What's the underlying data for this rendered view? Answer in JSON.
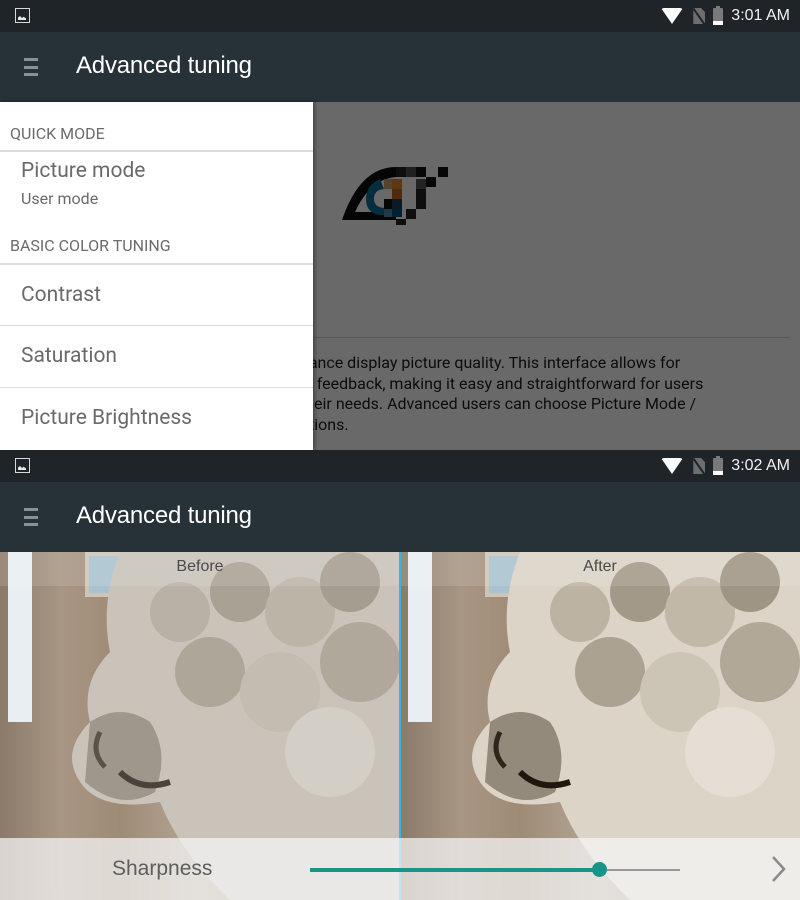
{
  "screens": [
    {
      "status_bar": {
        "time": "3:01 AM"
      },
      "app_bar": {
        "title": "Advanced tuning"
      },
      "drawer": {
        "sections": [
          {
            "header": "QUICK MODE",
            "items": [
              {
                "title": "Picture mode",
                "subtitle": "User mode"
              }
            ]
          },
          {
            "header": "BASIC COLOR TUNING",
            "items": [
              {
                "title": "Contrast"
              },
              {
                "title": "Saturation"
              },
              {
                "title": "Picture Brightness"
              }
            ]
          }
        ]
      },
      "main": {
        "logo": "eye-pixel-logo",
        "description_lines": [
          "hance display picture quality. This interface allows for",
          "ty feedback, making it easy and straightforward for users",
          "their needs. Advanced users can choose Picture Mode /",
          "ptions."
        ]
      }
    },
    {
      "status_bar": {
        "time": "3:02 AM"
      },
      "app_bar": {
        "title": "Advanced tuning"
      },
      "preview": {
        "before_label": "Before",
        "after_label": "After"
      },
      "control": {
        "label": "Sharpness",
        "value_fraction": 0.78,
        "accent_color": "#159688"
      }
    }
  ],
  "colors": {
    "status_bar": "#1f2428",
    "app_bar": "#263238",
    "accent": "#159688",
    "split_line": "#33b5e5"
  }
}
